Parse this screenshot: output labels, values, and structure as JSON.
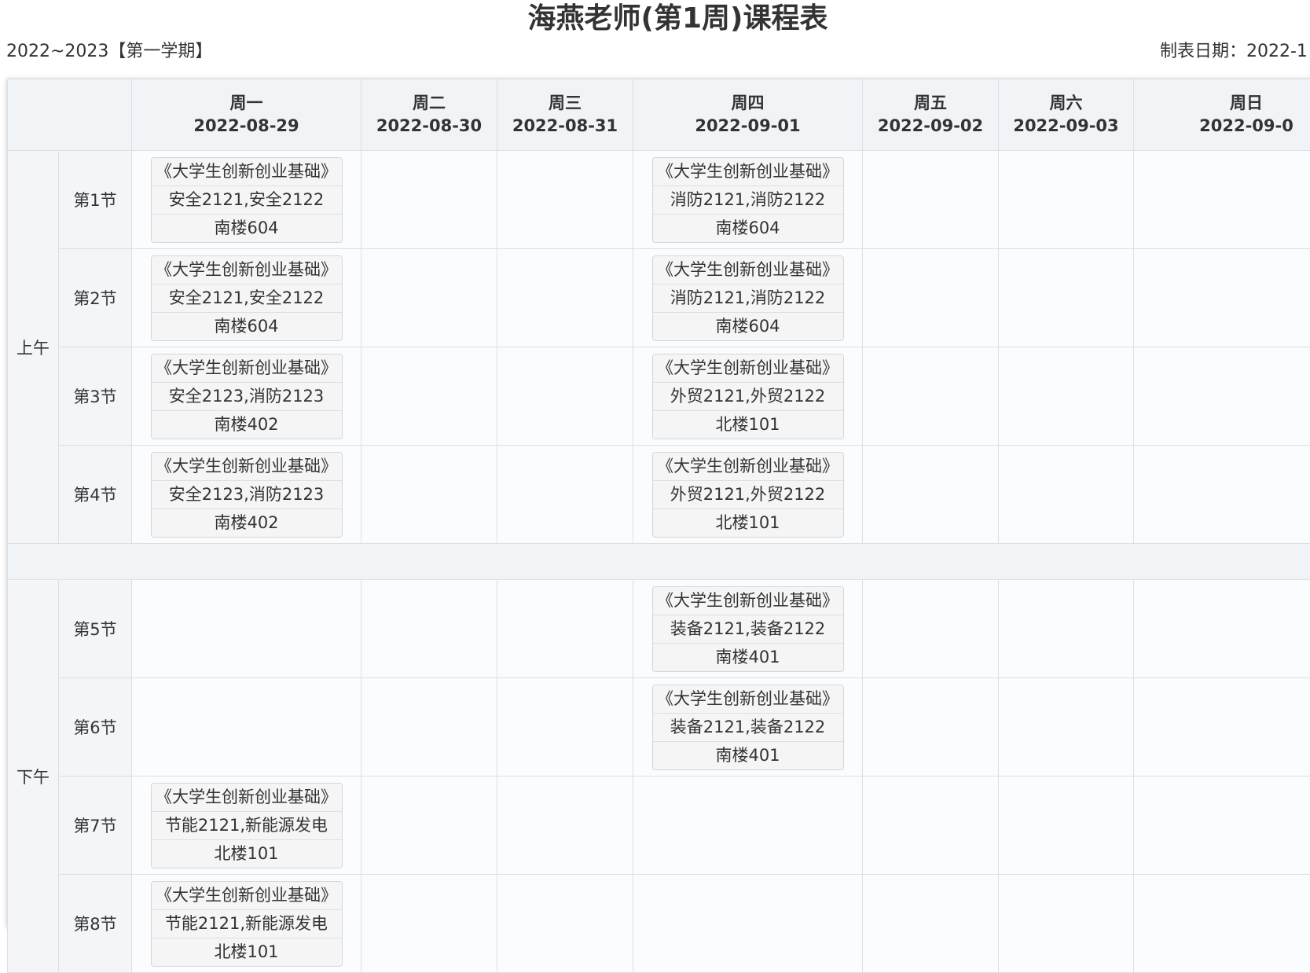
{
  "header": {
    "title": "海燕老师(第1周)课程表",
    "term": "2022~2023【第一学期】",
    "made_date": "制表日期：2022-1"
  },
  "days": [
    {
      "name": "周一",
      "date": "2022-08-29"
    },
    {
      "name": "周二",
      "date": "2022-08-30"
    },
    {
      "name": "周三",
      "date": "2022-08-31"
    },
    {
      "name": "周四",
      "date": "2022-09-01"
    },
    {
      "name": "周五",
      "date": "2022-09-02"
    },
    {
      "name": "周六",
      "date": "2022-09-03"
    },
    {
      "name": "周日",
      "date": "2022-09-0"
    }
  ],
  "groups": {
    "morning": "上午",
    "afternoon": "下午"
  },
  "periods": [
    "第1节",
    "第2节",
    "第3节",
    "第4节",
    "第5节",
    "第6节",
    "第7节",
    "第8节"
  ],
  "courses": {
    "p1_mon": {
      "course": "《大学生创新创业基础》",
      "classes": "安全2121,安全2122",
      "room": "南楼604"
    },
    "p1_thu": {
      "course": "《大学生创新创业基础》",
      "classes": "消防2121,消防2122",
      "room": "南楼604"
    },
    "p2_mon": {
      "course": "《大学生创新创业基础》",
      "classes": "安全2121,安全2122",
      "room": "南楼604"
    },
    "p2_thu": {
      "course": "《大学生创新创业基础》",
      "classes": "消防2121,消防2122",
      "room": "南楼604"
    },
    "p3_mon": {
      "course": "《大学生创新创业基础》",
      "classes": "安全2123,消防2123",
      "room": "南楼402"
    },
    "p3_thu": {
      "course": "《大学生创新创业基础》",
      "classes": "外贸2121,外贸2122",
      "room": "北楼101"
    },
    "p4_mon": {
      "course": "《大学生创新创业基础》",
      "classes": "安全2123,消防2123",
      "room": "南楼402"
    },
    "p4_thu": {
      "course": "《大学生创新创业基础》",
      "classes": "外贸2121,外贸2122",
      "room": "北楼101"
    },
    "p5_thu": {
      "course": "《大学生创新创业基础》",
      "classes": "装备2121,装备2122",
      "room": "南楼401"
    },
    "p6_thu": {
      "course": "《大学生创新创业基础》",
      "classes": "装备2121,装备2122",
      "room": "南楼401"
    },
    "p7_mon": {
      "course": "《大学生创新创业基础》",
      "classes": "节能2121,新能源发电",
      "room": "北楼101"
    },
    "p8_mon": {
      "course": "《大学生创新创业基础》",
      "classes": "节能2121,新能源发电",
      "room": "北楼101"
    }
  }
}
